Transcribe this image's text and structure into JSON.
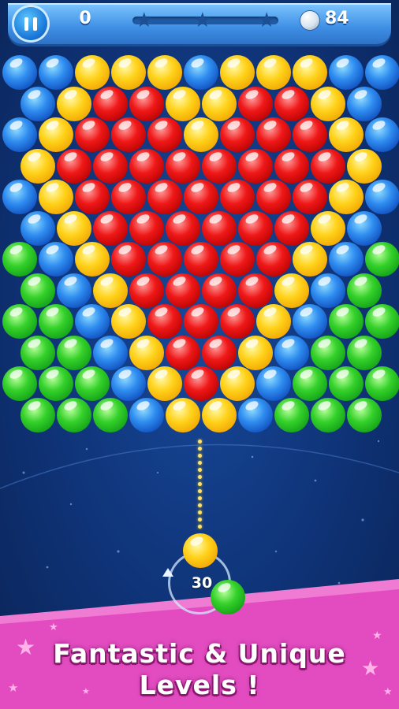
{
  "hud": {
    "pause_icon": "pause-icon",
    "score": "0",
    "level_progress": 0,
    "progress_stars": 3,
    "balls_icon": "white-ball-icon",
    "balls_remaining": "84"
  },
  "colors": {
    "b": "blue",
    "y": "yellow",
    "r": "red",
    "g": "green"
  },
  "grid": {
    "rows": [
      [
        "b",
        "b",
        "y",
        "y",
        "y",
        "b",
        "y",
        "y",
        "y",
        "b",
        "b"
      ],
      [
        "b",
        "y",
        "r",
        "r",
        "y",
        "y",
        "r",
        "r",
        "y",
        "b"
      ],
      [
        "b",
        "y",
        "r",
        "r",
        "r",
        "y",
        "r",
        "r",
        "r",
        "y",
        "b"
      ],
      [
        "y",
        "r",
        "r",
        "r",
        "r",
        "r",
        "r",
        "r",
        "r",
        "y"
      ],
      [
        "b",
        "y",
        "r",
        "r",
        "r",
        "r",
        "r",
        "r",
        "r",
        "y",
        "b"
      ],
      [
        "b",
        "y",
        "r",
        "r",
        "r",
        "r",
        "r",
        "r",
        "y",
        "b"
      ],
      [
        "g",
        "b",
        "y",
        "r",
        "r",
        "r",
        "r",
        "r",
        "y",
        "b",
        "g"
      ],
      [
        "g",
        "b",
        "y",
        "r",
        "r",
        "r",
        "r",
        "y",
        "b",
        "g"
      ],
      [
        "g",
        "g",
        "b",
        "y",
        "r",
        "r",
        "r",
        "y",
        "b",
        "g",
        "g"
      ],
      [
        "g",
        "g",
        "b",
        "y",
        "r",
        "r",
        "y",
        "b",
        "g",
        "g"
      ],
      [
        "g",
        "g",
        "g",
        "b",
        "y",
        "r",
        "y",
        "b",
        "g",
        "g",
        "g"
      ],
      [
        "g",
        "g",
        "g",
        "b",
        "y",
        "y",
        "b",
        "g",
        "g",
        "g"
      ]
    ]
  },
  "shooter": {
    "current_ball": "yellow",
    "next_ball": "green",
    "shots_left": "30",
    "swap_icon": "swap-arrow-icon"
  },
  "banner": {
    "line1": "Fantastic & Unique",
    "line2": "Levels !"
  }
}
